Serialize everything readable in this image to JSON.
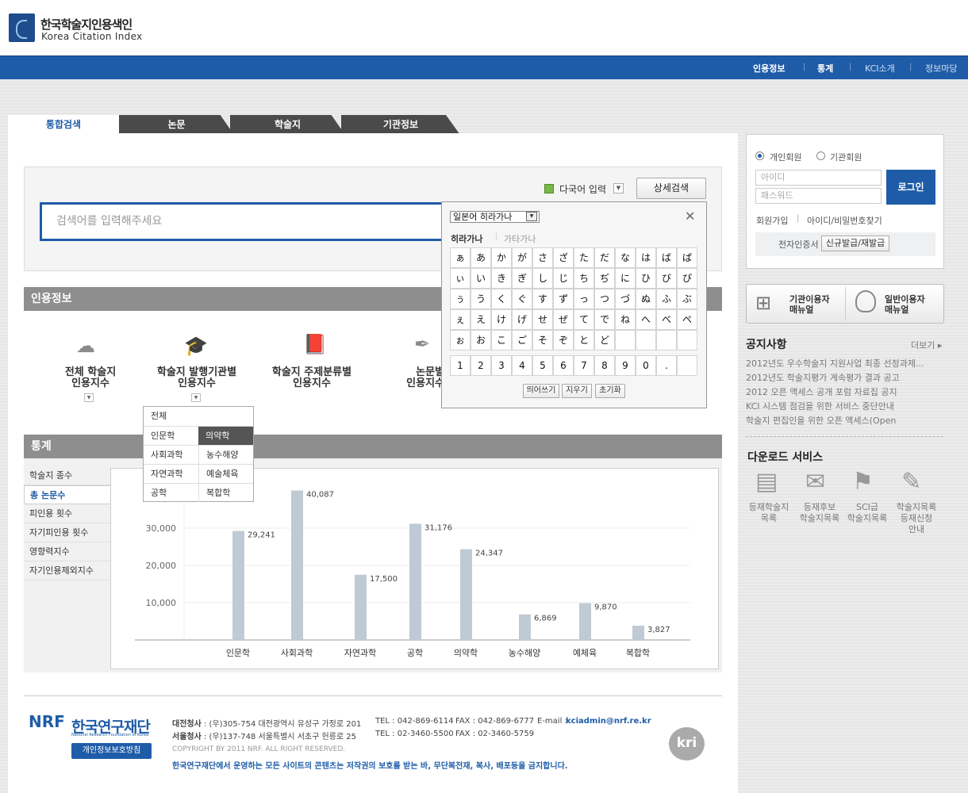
{
  "header": {
    "logo_ko": "한국학술지인용색인",
    "logo_en": "Korea Citation Index",
    "nav": [
      "인용정보",
      "통계",
      "KCI소개",
      "정보마당"
    ]
  },
  "tabs": [
    "통합검색",
    "논문",
    "학술지",
    "기관정보"
  ],
  "search": {
    "placeholder": "검색어를 입력해주세요",
    "multilang_label": "다국어 입력",
    "detail_button": "상세검색"
  },
  "keyboard": {
    "selected_mode": "일본어 히라가나",
    "tab_hiragana": "히라가나",
    "tab_katakana": "가타가나",
    "rows": [
      [
        "ぁ",
        "あ",
        "か",
        "が",
        "さ",
        "ざ",
        "た",
        "だ",
        "な",
        "は",
        "ば",
        "ぱ"
      ],
      [
        "ぃ",
        "い",
        "き",
        "ぎ",
        "し",
        "じ",
        "ち",
        "ぢ",
        "に",
        "ひ",
        "び",
        "ぴ"
      ],
      [
        "ぅ",
        "う",
        "く",
        "ぐ",
        "す",
        "ず",
        "っ",
        "つ",
        "づ",
        "ぬ",
        "ふ",
        "ぶ"
      ],
      [
        "ぇ",
        "え",
        "け",
        "げ",
        "せ",
        "ぜ",
        "て",
        "で",
        "ね",
        "へ",
        "べ",
        "ぺ"
      ],
      [
        "ぉ",
        "お",
        "こ",
        "ご",
        "そ",
        "ぞ",
        "と",
        "ど"
      ]
    ],
    "numbers": [
      "1",
      "2",
      "3",
      "4",
      "5",
      "6",
      "7",
      "8",
      "9",
      "0",
      "."
    ],
    "buttons": [
      "띄어쓰기",
      "지우기",
      "초기화"
    ]
  },
  "citation": {
    "title": "인용정보",
    "items": [
      {
        "line1": "전체 학술지",
        "line2": "인용지수",
        "icon": "cloud-icon"
      },
      {
        "line1": "학술지 발행기관별",
        "line2": "인용지수",
        "icon": "graduation-cap-icon"
      },
      {
        "line1": "학술지 주제분류별",
        "line2": "인용지수",
        "icon": "book-icon"
      },
      {
        "line1": "논문별",
        "line2": "인용지수",
        "icon": "pen-icon"
      }
    ],
    "field_menu": {
      "all": "전체",
      "items": [
        "인문학",
        "의약학",
        "사회과학",
        "농수해양",
        "자연과학",
        "예술체육",
        "공학",
        "복합학"
      ],
      "selected": "의약학"
    }
  },
  "stats": {
    "title": "통계",
    "menu": [
      "학술지 종수",
      "총 논문수",
      "피인용 횟수",
      "자기피인용 횟수",
      "영향력지수",
      "자기인용제외지수"
    ],
    "active": "총 논문수"
  },
  "chart_data": {
    "type": "bar",
    "categories": [
      "인문학",
      "사회과학",
      "자연과학",
      "공학",
      "의약학",
      "농수해양",
      "예체육",
      "복합학"
    ],
    "values": [
      29241,
      40087,
      17500,
      31176,
      24347,
      6869,
      9870,
      3827
    ],
    "value_labels": [
      "29,241",
      "40,087",
      "17,500",
      "31,176",
      "24,347",
      "6,869",
      "9,870",
      "3,827"
    ],
    "yticks": [
      "10,000",
      "20,000",
      "30,000"
    ],
    "ylim": [
      0,
      40000
    ],
    "bar_color": "#c0cad4"
  },
  "login": {
    "member_personal": "개인회원",
    "member_org": "기관회원",
    "id_placeholder": "아이디",
    "pw_placeholder": "패스워드",
    "login_button": "로그인",
    "join": "회원가입",
    "find": "아이디/비밀번호찾기",
    "cert_label": "전자인증서",
    "cert_button": "신규발급/재발급"
  },
  "manuals": [
    {
      "line1": "기관이용자",
      "line2": "매뉴얼"
    },
    {
      "line1": "일반이용자",
      "line2": "매뉴얼"
    }
  ],
  "notices": {
    "title": "공지사항",
    "more": "더보기",
    "items": [
      "2012년도 우수학술지 지원사업 최종 선정과제...",
      "2012년도 학술지평가 계속평가 결과 공고",
      "2012 오픈 액세스 공개 포럼 자료집 공지",
      "KCI 시스템 점검을 위한 서비스 중단안내",
      "학술지 편집인을 위한 오픈 액세스(Open"
    ]
  },
  "downloads": {
    "title": "다운로드 서비스",
    "items": [
      {
        "line1": "등재학술지",
        "line2": "목록",
        "line3": ""
      },
      {
        "line1": "등재후보",
        "line2": "학술지목록",
        "line3": ""
      },
      {
        "line1": "SCI급",
        "line2": "학술지목록",
        "line3": ""
      },
      {
        "line1": "학술지목록",
        "line2": "등재신청",
        "line3": "안내"
      }
    ]
  },
  "footer": {
    "nrf_logo": "NRF",
    "nrf_name": "한국연구재단",
    "nrf_en": "National Research Foundation of Korea",
    "privacy": "개인정보보호방침",
    "daejeon_label": "대전청사",
    "daejeon_addr": ": (우)305-754 대전광역시 유성구 가정로 201",
    "daejeon_tel": "TEL : 042-869-6114",
    "daejeon_fax": "FAX : 042-869-6777",
    "email_label": "E-mail :",
    "email": "kciadmin@nrf.re.kr",
    "seoul_label": "서울청사",
    "seoul_addr": ": (우)137-748 서울특별시 서초구 헌릉로 25",
    "seoul_tel": "TEL : 02-3460-5500",
    "seoul_fax": "FAX : 02-3460-5759",
    "copyright": "COPYRIGHT BY 2011 NRF. ALL RIGHT RESERVED.",
    "notice": "한국연구재단에서 운영하는 모든 사이트의 콘텐츠는 저작권의 보호를 받는 바, 무단복전재, 복사, 배포등을 금지합니다.",
    "kri": "kri"
  }
}
